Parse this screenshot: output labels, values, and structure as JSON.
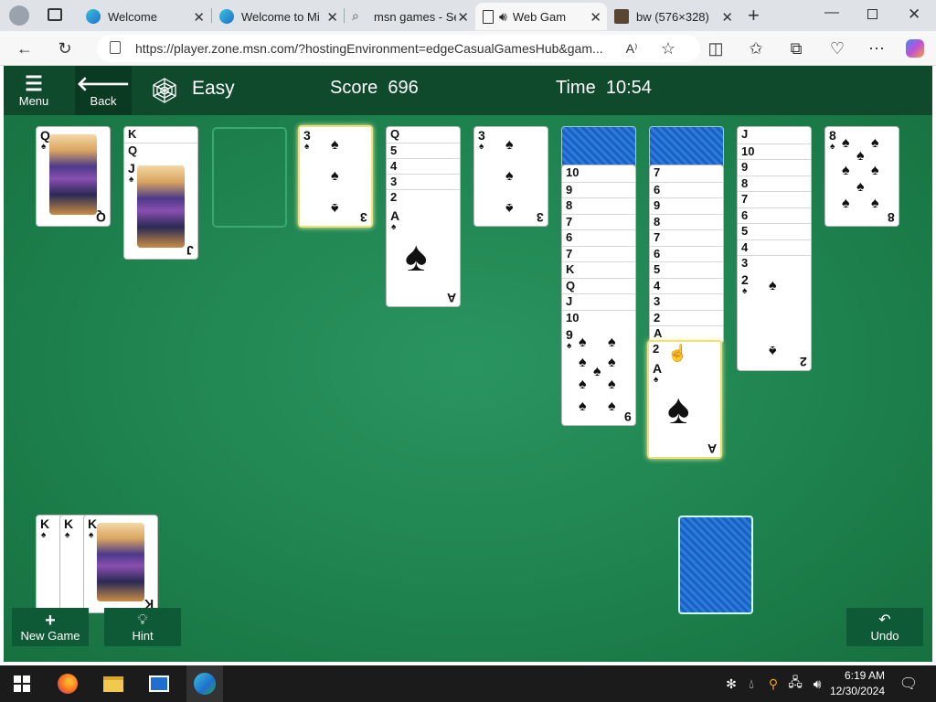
{
  "browser": {
    "tabs": [
      {
        "title": "Welcome",
        "icon": "edge-icon"
      },
      {
        "title": "Welcome to Mi",
        "icon": "edge-icon"
      },
      {
        "title": "msn games - Se",
        "icon": "search-icon"
      },
      {
        "title": "Web Game",
        "icon": "page-icon"
      },
      {
        "title": "bw (576×328)",
        "icon": "image-icon"
      }
    ],
    "url": "https://player.zone.msn.com/?hostingEnvironment=edgeCasualGamesHub&gam..."
  },
  "game": {
    "menu_label": "Menu",
    "back_label": "Back",
    "difficulty": "Easy",
    "score_label": "Score",
    "score_value": "696",
    "time_label": "Time",
    "time_value": "10:54",
    "new_game_label": "New Game",
    "hint_label": "Hint",
    "undo_label": "Undo",
    "tableau": [
      {
        "top_card": "Q",
        "cards": [
          "Q"
        ]
      },
      {
        "cards": [
          "K",
          "Q",
          "J"
        ]
      },
      {
        "cards": []
      },
      {
        "cards": [
          "3"
        ]
      },
      {
        "cards": [
          "Q",
          "5",
          "4",
          "3",
          "2",
          "A"
        ]
      },
      {
        "cards": [
          "3"
        ]
      },
      {
        "hidden": 4,
        "cards": [
          "10",
          "9",
          "8",
          "7",
          "6",
          "7",
          "K",
          "Q",
          "J",
          "10",
          "9"
        ]
      },
      {
        "hidden": 4,
        "cards": [
          "7",
          "6",
          "9",
          "8",
          "7",
          "6",
          "5",
          "4",
          "3",
          "2",
          "A",
          "2",
          "A"
        ]
      },
      {
        "cards": [
          "J",
          "10",
          "9",
          "8",
          "7",
          "6",
          "5",
          "4",
          "3",
          "2"
        ]
      },
      {
        "cards": [
          "8"
        ]
      }
    ],
    "foundation": [
      "K",
      "K",
      "K"
    ]
  },
  "taskbar": {
    "time": "6:19 AM",
    "date": "12/30/2024"
  },
  "colors": {
    "felt": "#1f8652",
    "header": "#0f4a2d",
    "card_back": "#1b66c9",
    "highlight": "#f0e07a"
  }
}
